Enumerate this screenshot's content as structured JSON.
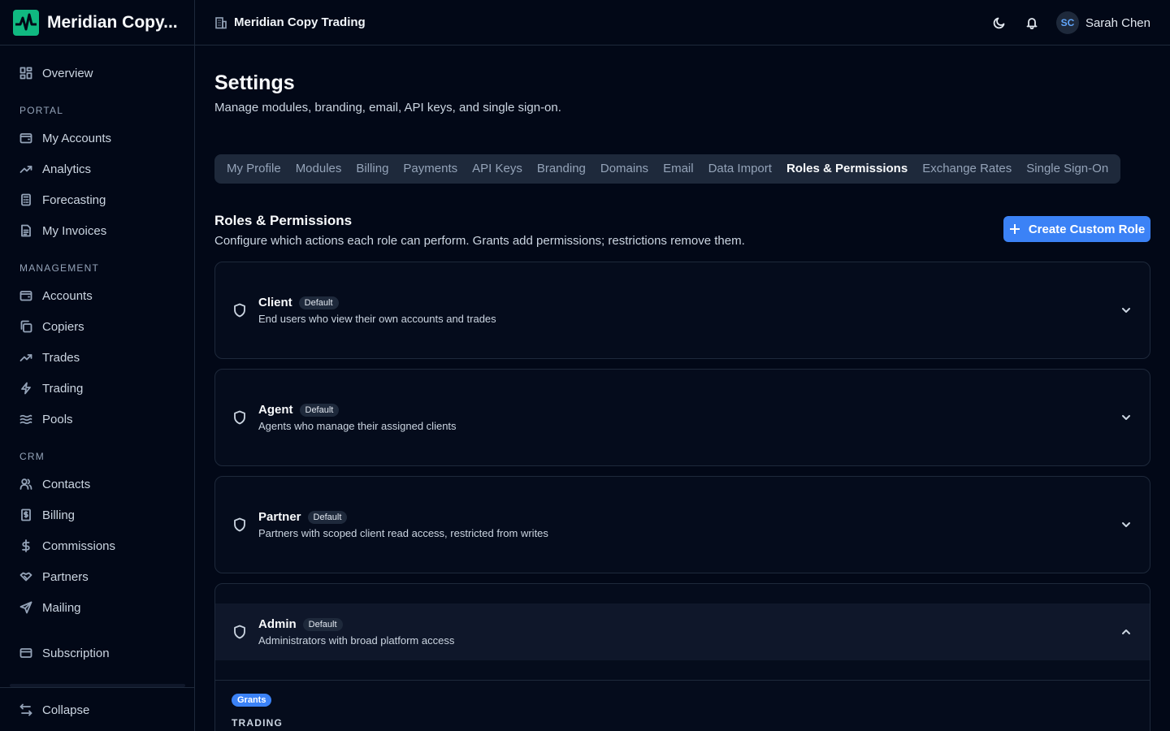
{
  "brand": {
    "name": "Meridian Copy..."
  },
  "topbar": {
    "org_name": "Meridian Copy Trading",
    "user_initials": "SC",
    "user_name": "Sarah Chen"
  },
  "sidebar": {
    "overview": "Overview",
    "sections": {
      "portal": "PORTAL",
      "management": "MANAGEMENT",
      "crm": "CRM"
    },
    "portal_items": [
      "My Accounts",
      "Analytics",
      "Forecasting",
      "My Invoices"
    ],
    "management_items": [
      "Accounts",
      "Copiers",
      "Trades",
      "Trading",
      "Pools"
    ],
    "crm_items": [
      "Contacts",
      "Billing",
      "Commissions",
      "Partners",
      "Mailing"
    ],
    "subscription": "Subscription",
    "collapse": "Collapse"
  },
  "page": {
    "title": "Settings",
    "subtitle": "Manage modules, branding, email, API keys, and single sign-on."
  },
  "tabs": [
    "My Profile",
    "Modules",
    "Billing",
    "Payments",
    "API Keys",
    "Branding",
    "Domains",
    "Email",
    "Data Import",
    "Roles & Permissions",
    "Exchange Rates",
    "Single Sign-On"
  ],
  "active_tab": "Roles & Permissions",
  "roles_section": {
    "title": "Roles & Permissions",
    "subtitle": "Configure which actions each role can perform. Grants add permissions; restrictions remove them.",
    "create_button": "Create Custom Role"
  },
  "roles": [
    {
      "name": "Client",
      "badge": "Default",
      "description": "End users who view their own accounts and trades",
      "expanded": false
    },
    {
      "name": "Agent",
      "badge": "Default",
      "description": "Agents who manage their assigned clients",
      "expanded": false
    },
    {
      "name": "Partner",
      "badge": "Default",
      "description": "Partners with scoped client read access, restricted from writes",
      "expanded": false
    },
    {
      "name": "Admin",
      "badge": "Default",
      "description": "Administrators with broad platform access",
      "expanded": true
    }
  ],
  "admin_detail": {
    "grants_label": "Grants",
    "group": "TRADING"
  },
  "colors": {
    "background": "#020817",
    "accent": "#3b82f6",
    "border": "#1e293b",
    "brand_green": "#10b981"
  }
}
